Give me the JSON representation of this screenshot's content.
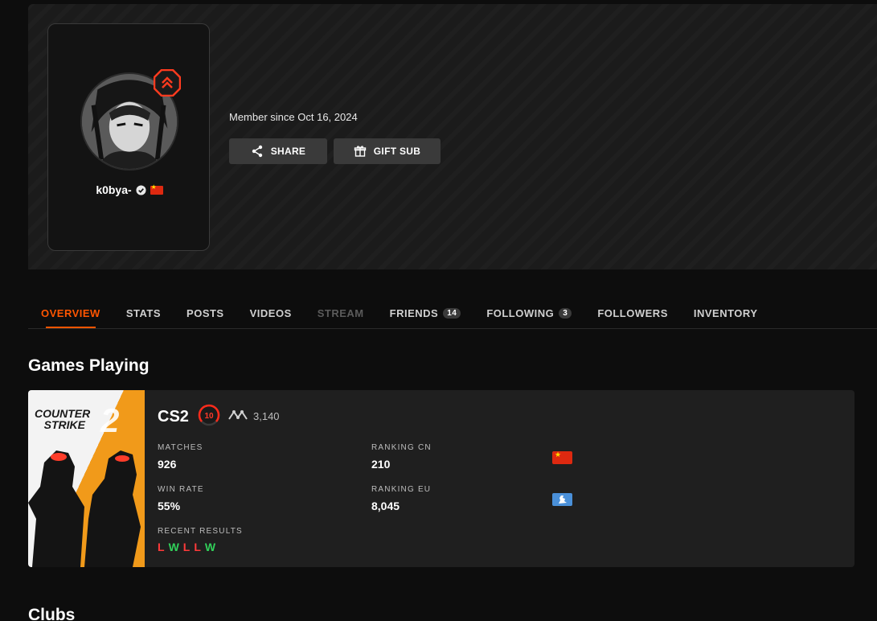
{
  "profile": {
    "username": "k0bya-",
    "member_since": "Member since Oct 16, 2024",
    "share_label": "SHARE",
    "gift_label": "GIFT SUB"
  },
  "tabs": [
    {
      "label": "OVERVIEW",
      "state": "active"
    },
    {
      "label": "STATS",
      "state": "normal"
    },
    {
      "label": "POSTS",
      "state": "normal"
    },
    {
      "label": "VIDEOS",
      "state": "normal"
    },
    {
      "label": "STREAM",
      "state": "disabled"
    },
    {
      "label": "FRIENDS",
      "state": "normal",
      "count": "14"
    },
    {
      "label": "FOLLOWING",
      "state": "normal",
      "count": "3"
    },
    {
      "label": "FOLLOWERS",
      "state": "normal"
    },
    {
      "label": "INVENTORY",
      "state": "normal"
    }
  ],
  "sections": {
    "games_title": "Games Playing",
    "clubs_title": "Clubs"
  },
  "game": {
    "art_title_line1": "COUNTER",
    "art_title_line2": "STRIKE",
    "art_title_numeral": "2",
    "name": "CS2",
    "skill_level": "10",
    "elo": "3,140",
    "matches_label": "MATCHES",
    "matches": "926",
    "ranking_cn_label": "RANKING CN",
    "ranking_cn": "210",
    "win_rate_label": "WIN RATE",
    "win_rate": "55%",
    "ranking_eu_label": "RANKING EU",
    "ranking_eu": "8,045",
    "recent_results_label": "RECENT RESULTS",
    "recent_results": [
      "L",
      "W",
      "L",
      "L",
      "W"
    ]
  },
  "colors": {
    "accent": "#ff5500",
    "loss": "#ff3a3a",
    "win": "#31d15a",
    "background": "#0d0d0d",
    "card": "#1f1f1f"
  },
  "icons": {
    "share": "share-icon",
    "gift": "gift-icon",
    "verified": "verified-check-icon",
    "level": "level-chevron-badge-icon",
    "elo": "elo-trend-icon",
    "skill": "skill-level-icon",
    "cn_flag": "china-flag-icon",
    "eu_flag": "europe-region-icon"
  }
}
